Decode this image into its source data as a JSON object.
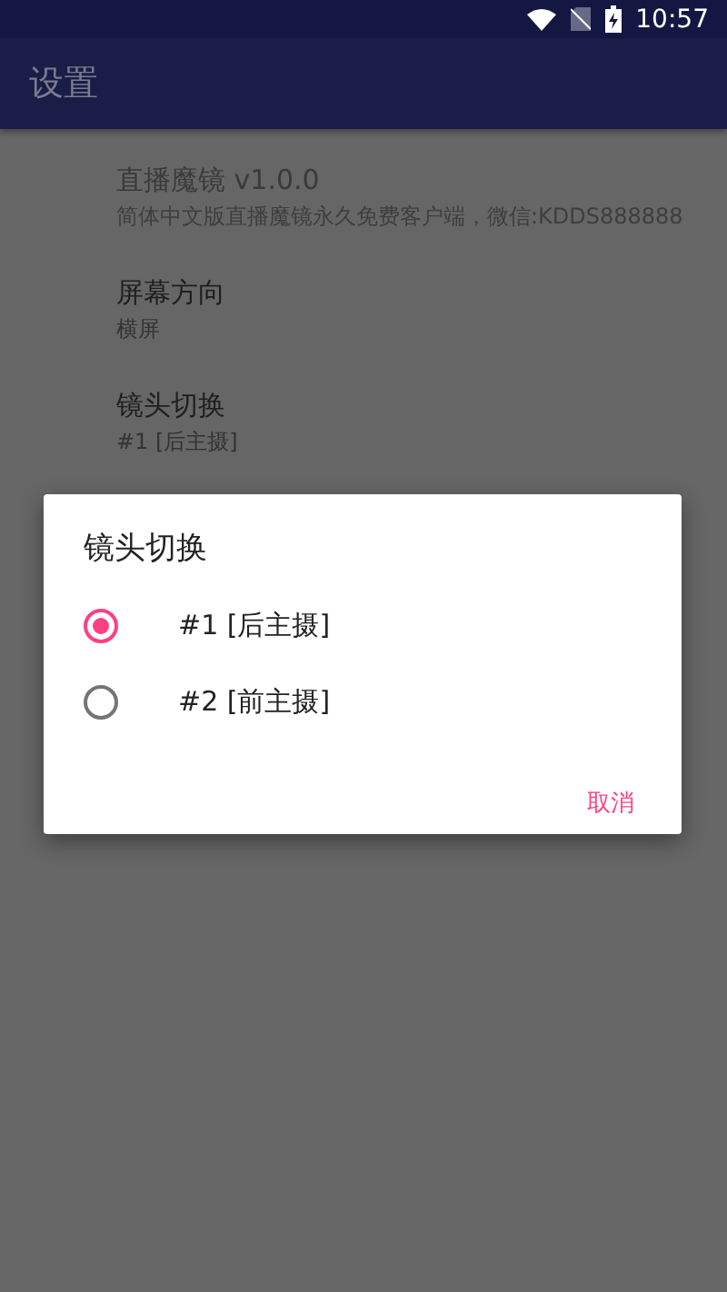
{
  "status_bar": {
    "time": "10:57"
  },
  "app_bar": {
    "title": "设置"
  },
  "settings": [
    {
      "title": "直播魔镜 v1.0.0",
      "summary": "简体中文版直播魔镜永久免费客户端，微信:KDDS888888",
      "disabled": true
    },
    {
      "title": "屏幕方向",
      "summary": "横屏",
      "disabled": false
    },
    {
      "title": "镜头切换",
      "summary": "#1 [后主摄]",
      "disabled": false
    }
  ],
  "dialog": {
    "title": "镜头切换",
    "options": [
      {
        "label": "#1 [后主摄]",
        "selected": true
      },
      {
        "label": "#2 [前主摄]",
        "selected": false
      }
    ],
    "buttons": [
      "取消"
    ]
  }
}
